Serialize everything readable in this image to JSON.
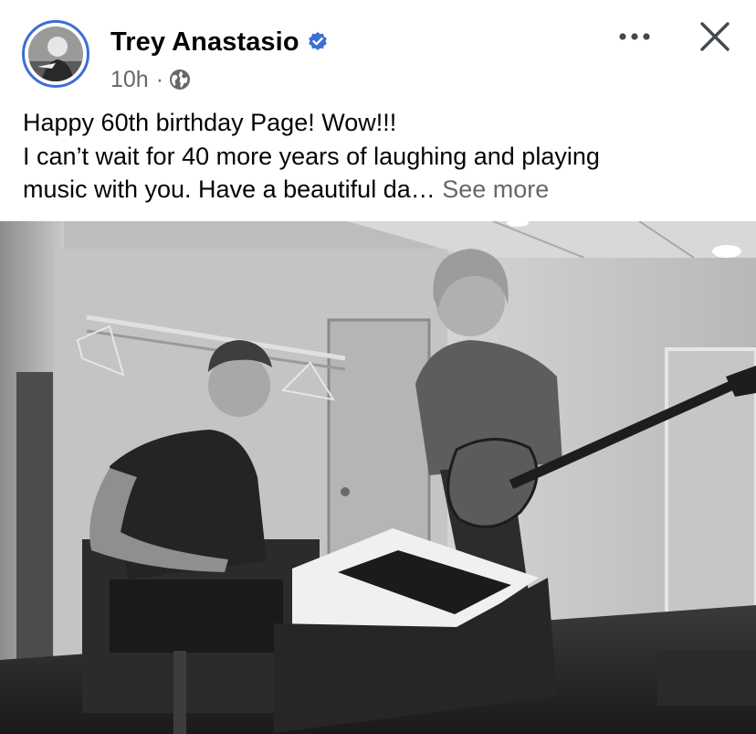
{
  "author": {
    "name": "Trey Anastasio",
    "verified_icon": "verified-badge-icon",
    "avatar_icon": "avatar"
  },
  "meta": {
    "time": "10h",
    "separator": "·",
    "audience_icon": "globe-icon"
  },
  "actions": {
    "more_icon": "more-options-icon",
    "close_icon": "close-icon"
  },
  "post": {
    "lines": [
      "Happy 60th birthday Page! Wow!!!",
      "I can’t wait for 40 more years of laughing and playing",
      "music with you. Have a beautiful da…"
    ],
    "see_more": "See more"
  },
  "colors": {
    "accent": "#3b6fd4",
    "secondary_text": "#65676b",
    "primary_text": "#050505"
  }
}
